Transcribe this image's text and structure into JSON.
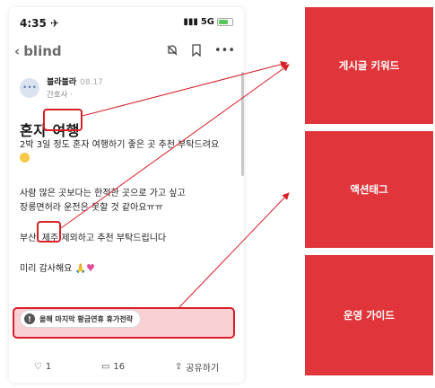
{
  "status_bar": {
    "time": "4:35 ✈",
    "signal": "5G"
  },
  "nav": {
    "back_label": "blind"
  },
  "post": {
    "author_name": "블라블라",
    "author_time": "08.17",
    "author_role": "간호사 ·",
    "title": "혼자 여행",
    "body_line1": "2박 3일 정도 혼자 여행하기 좋은 곳 추천 부탁드려요",
    "body_line2a": "사람 많은 곳보다는 한적한 곳으로 가고 싶고",
    "body_line2b": "장롱면허라 운전은 못할 것 같아요ㅠㅠ",
    "body_line3": "부산, 제주 제외하고 추천 부탁드립니다",
    "body_line4": "미리 감사해요"
  },
  "tag": {
    "label": "올해 마지막 황금연휴 휴가전략"
  },
  "actions": {
    "likes": "1",
    "comments": "16",
    "share": "공유하기"
  },
  "labels": {
    "keyword": "게시글 키워드",
    "action_tag": "액션태그",
    "guide": "운영 가이드"
  },
  "colors": {
    "accent_red": "#e0363b",
    "highlight": "#d8202a"
  }
}
